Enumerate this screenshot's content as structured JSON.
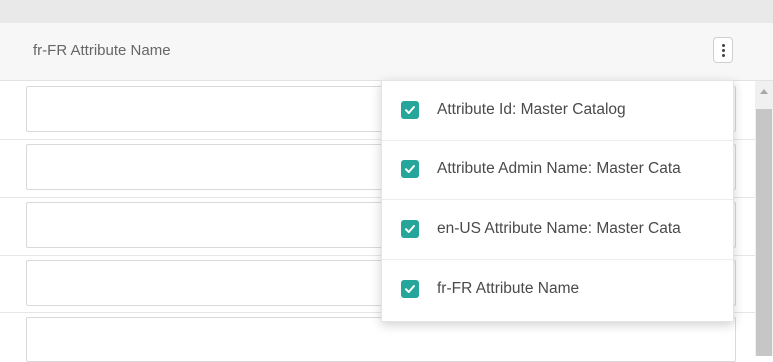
{
  "column_header": {
    "title": "fr-FR Attribute Name"
  },
  "column_menu": {
    "items": [
      {
        "label": "Attribute Id: Master Catalog",
        "checked": true
      },
      {
        "label": "Attribute Admin Name: Master Cata",
        "checked": true
      },
      {
        "label": "en-US Attribute Name: Master Cata",
        "checked": true
      },
      {
        "label": "fr-FR Attribute Name",
        "checked": true
      }
    ]
  },
  "colors": {
    "checkbox_accent": "#26a69a"
  },
  "icons": {
    "menu": "kebab-vertical-icon",
    "check": "checkmark-icon"
  }
}
